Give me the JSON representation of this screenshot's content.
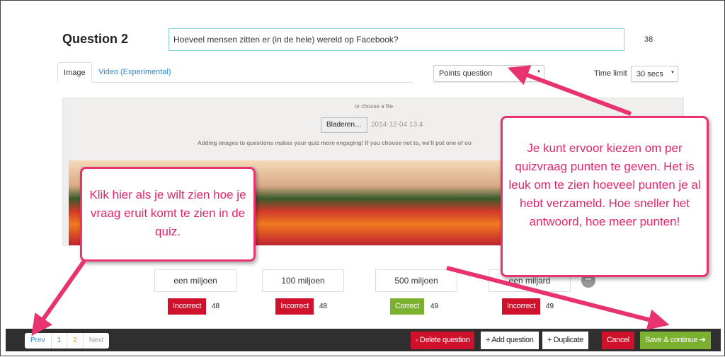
{
  "question": {
    "title": "Question 2",
    "text": "Hoeveel mensen zitten er (in de hele) wereld op Facebook?",
    "char_count": "38"
  },
  "tabs": [
    {
      "label": "Image",
      "active": true
    },
    {
      "label": "Video (Experimental)",
      "active": false
    }
  ],
  "question_type": {
    "selected": "Points question"
  },
  "time_limit": {
    "label": "Time limit",
    "selected": "30 secs"
  },
  "upload": {
    "or_choose": "or choose a file",
    "browse_label": "Bladeren…",
    "file_name": "2014-12-04 13.4",
    "hint": "Adding images to questions makes your quiz more engaging! If you choose not to, we'll put one of ou"
  },
  "answers": [
    {
      "text": "een miljoen",
      "status": "Incorrect",
      "points": "48"
    },
    {
      "text": "100 miljoen",
      "status": "Incorrect",
      "points": "48"
    },
    {
      "text": "500 miljoen",
      "status": "Correct",
      "points": "49"
    },
    {
      "text": "een miljard",
      "status": "Incorrect",
      "points": "49"
    }
  ],
  "remove_answer": "−",
  "pager": {
    "prev": "Prev",
    "pages": [
      "1",
      "2"
    ],
    "current": "2",
    "next": "Next"
  },
  "actions": {
    "delete": "- Delete question",
    "add": "+ Add question",
    "duplicate": "+ Duplicate",
    "cancel": "Cancel",
    "save": "Save & continue ➔"
  },
  "callouts": {
    "left": "Klik hier als je wilt zien hoe je vraag eruit komt te zien in de quiz.",
    "right": "Je kunt ervoor kiezen om per quizvraag punten te geven. Het is leuk om te zien hoeveel punten je al hebt verzameld. Hoe sneller het antwoord, hoe meer punten!"
  },
  "colors": {
    "accent_pink": "#e8336e",
    "incorrect": "#d0112b",
    "correct": "#7bb12f",
    "link": "#2a8ad4"
  }
}
